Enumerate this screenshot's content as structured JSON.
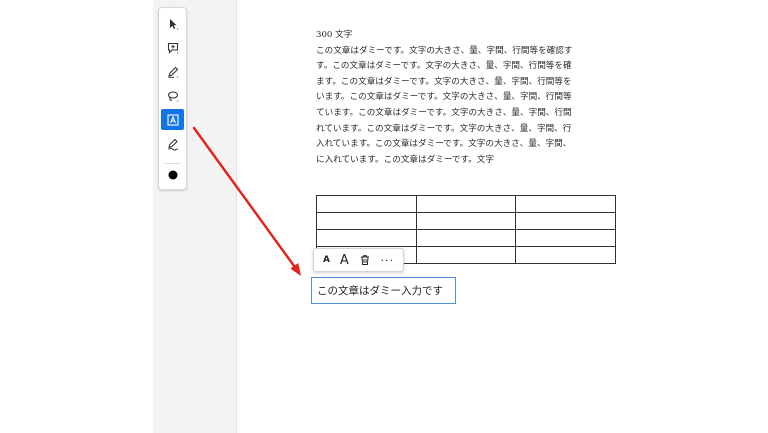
{
  "toolbar": {
    "tools": [
      {
        "icon": "select-arrow-icon"
      },
      {
        "icon": "comment-icon"
      },
      {
        "icon": "pen-icon"
      },
      {
        "icon": "lasso-icon"
      },
      {
        "icon": "text-box-icon",
        "active": true
      },
      {
        "icon": "fill-sign-icon"
      },
      {
        "icon": "color-dot-icon"
      }
    ],
    "active_color": "#1473e6"
  },
  "document": {
    "heading": "300 文字",
    "lines": [
      "この文章はダミーです。文字の大きさ、量、字間、行間等を確認す",
      "す。この文章はダミーです。文字の大きさ、量、字間、行間等を確",
      "ます。この文章はダミーです。文字の大きさ、量、字間、行間等を",
      "います。この文章はダミーです。文字の大きさ、量、字間、行間等",
      "ています。この文章はダミーです。文字の大きさ、量、字間、行間",
      "れています。この文章はダミーです。文字の大きさ、量、字間、行",
      "入れています。この文章はダミーです。文字の大きさ、量、字間、",
      "に入れています。この文章はダミーです。文字"
    ]
  },
  "text_format_bar": {
    "decrease_label": "A",
    "increase_label": "A",
    "more_label": "···"
  },
  "text_box": {
    "value": "この文章はダミー入力です"
  },
  "annotation": {
    "arrow_color": "#e8201a"
  }
}
